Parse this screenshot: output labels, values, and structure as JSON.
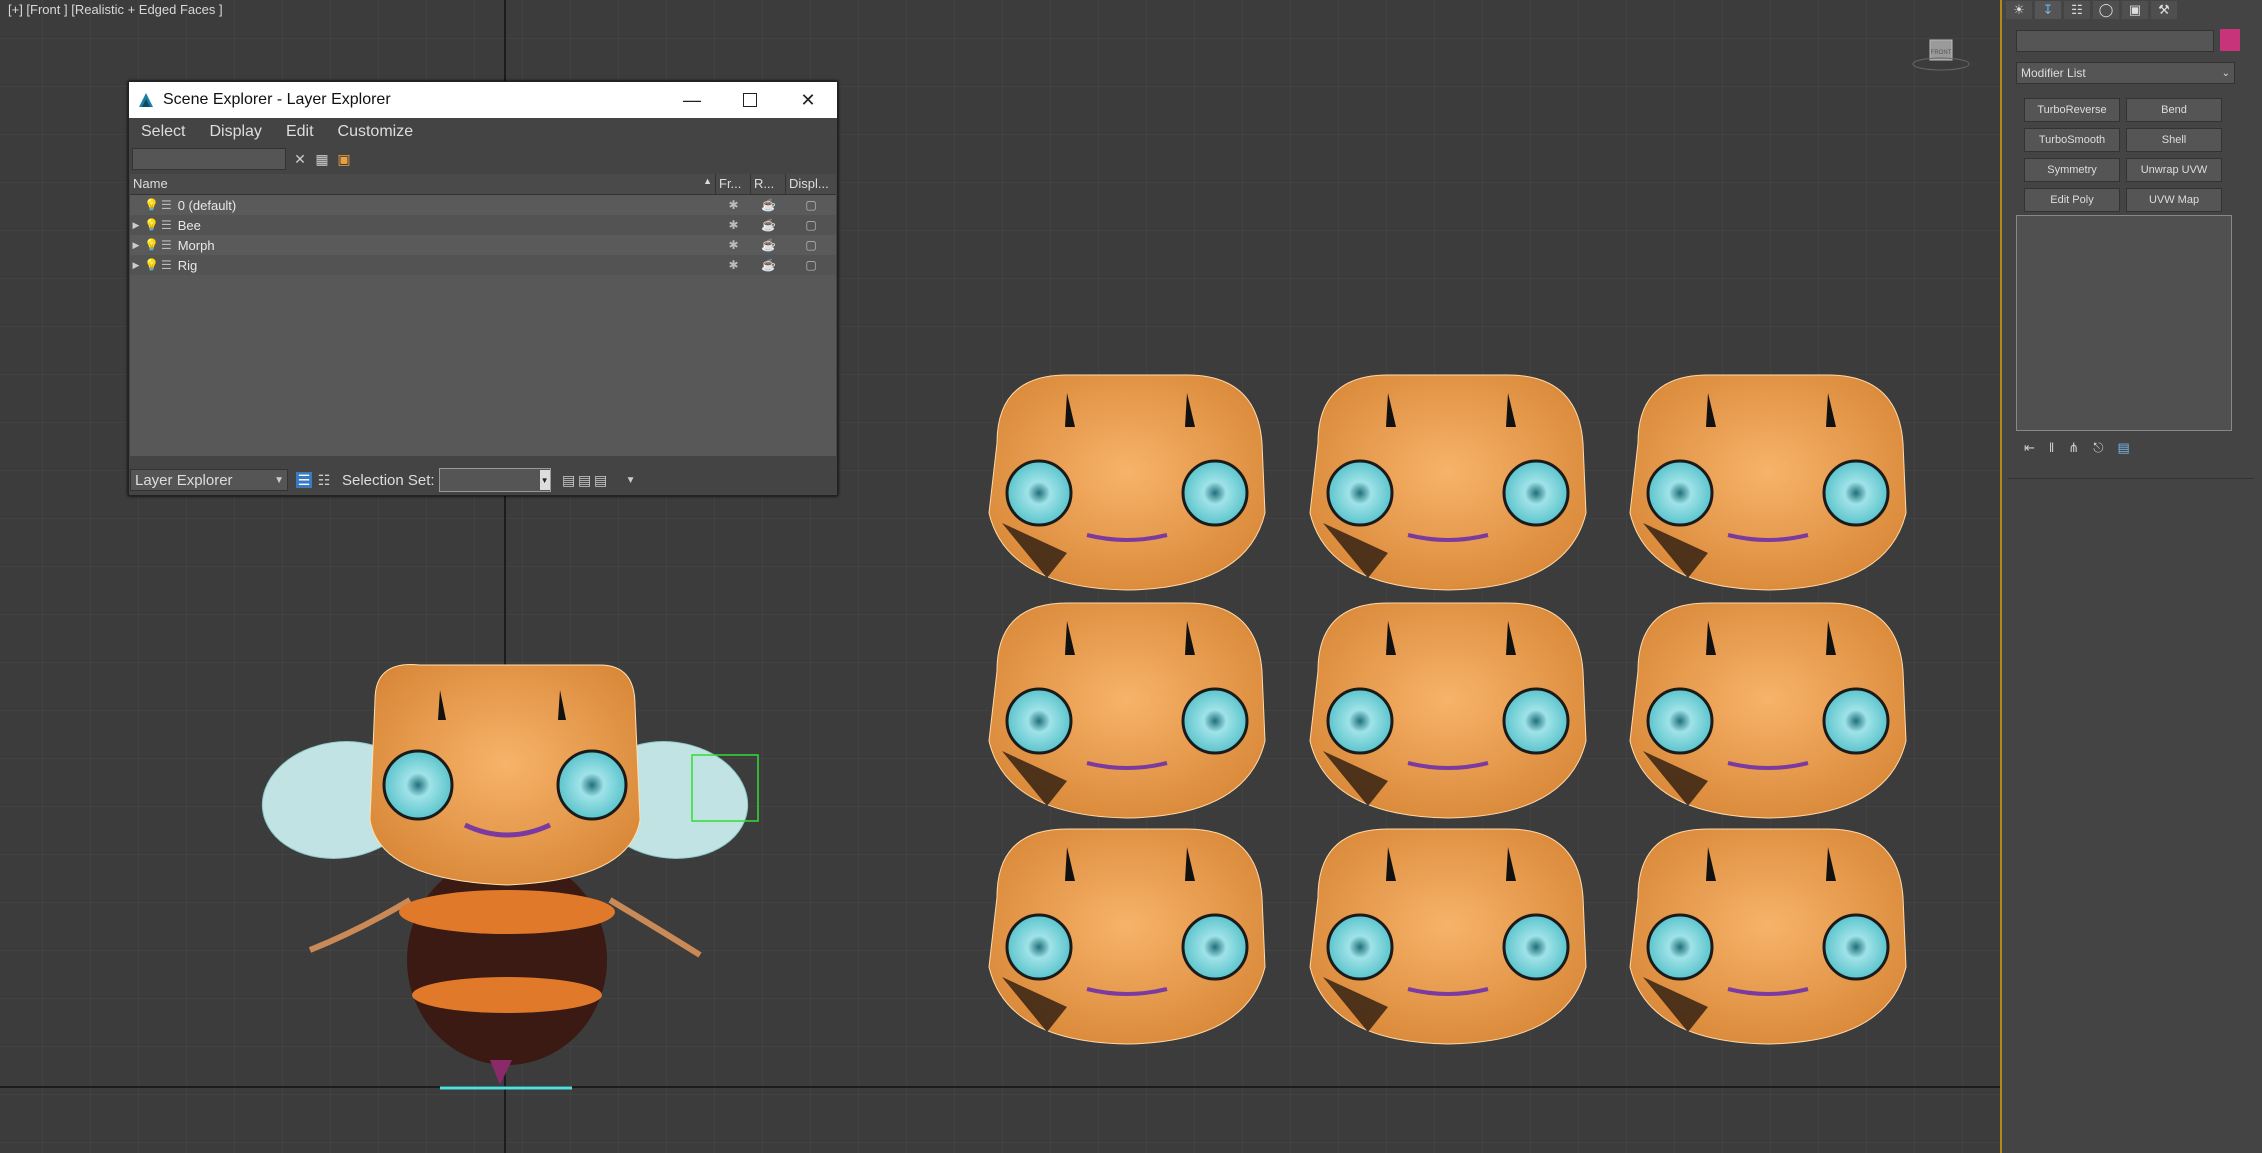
{
  "viewport": {
    "label": "[+] [Front ] [Realistic + Edged Faces ]",
    "viewcube_label": "FRONT"
  },
  "explorer": {
    "title": "Scene Explorer - Layer Explorer",
    "menu": [
      "Select",
      "Display",
      "Edit",
      "Customize"
    ],
    "columns": [
      "Name",
      "Fr...",
      "R...",
      "Displ..."
    ],
    "rows": [
      {
        "name": "0 (default)",
        "expandable": false
      },
      {
        "name": "Bee",
        "expandable": true
      },
      {
        "name": "Morph",
        "expandable": true
      },
      {
        "name": "Rig",
        "expandable": true
      }
    ],
    "status": {
      "explorer_mode": "Layer Explorer",
      "selection_set_label": "Selection Set:"
    }
  },
  "command_panel": {
    "modifier_list": "Modifier List",
    "color_swatch": "#c8347a",
    "modifier_buttons": [
      "TurboReverse",
      "Bend",
      "TurboSmooth",
      "Shell",
      "Symmetry",
      "Unwrap UVW",
      "Edit Poly",
      "UVW Map"
    ]
  },
  "colors": {
    "viewport_bg": "#3c3c3c",
    "head_orange": "#f0a55a",
    "eye_cyan": "#9fe3e8",
    "wing": "#c9ecec",
    "selection_green": "#33dd33",
    "panel_border": "#b28a1a"
  }
}
